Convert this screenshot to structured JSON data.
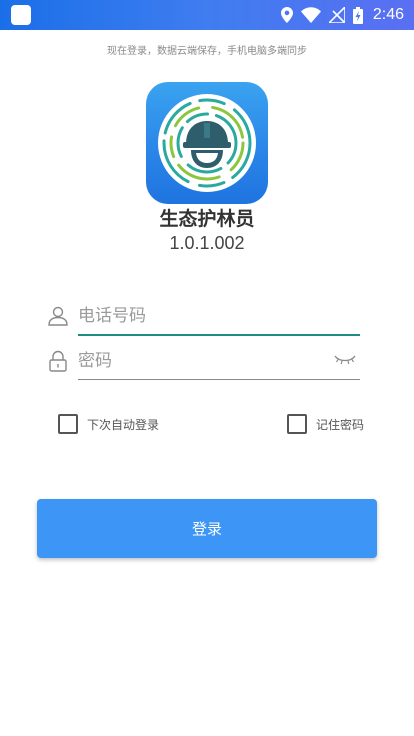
{
  "status_bar": {
    "time": "2:46"
  },
  "tagline": "现在登录，数据云端保存，手机电脑多端同步",
  "app": {
    "name": "生态护林员",
    "version": "1.0.1.002"
  },
  "form": {
    "phone": {
      "placeholder": "电话号码",
      "value": ""
    },
    "password": {
      "placeholder": "密码",
      "value": ""
    },
    "auto_login_label": "下次自动登录",
    "remember_password_label": "记住密码",
    "login_button_label": "登录"
  },
  "colors": {
    "status_bar": "#3f7df0",
    "primary_button": "#3d96f5",
    "focus_underline": "#1e8c84",
    "logo_bg": "#2b86e8"
  }
}
